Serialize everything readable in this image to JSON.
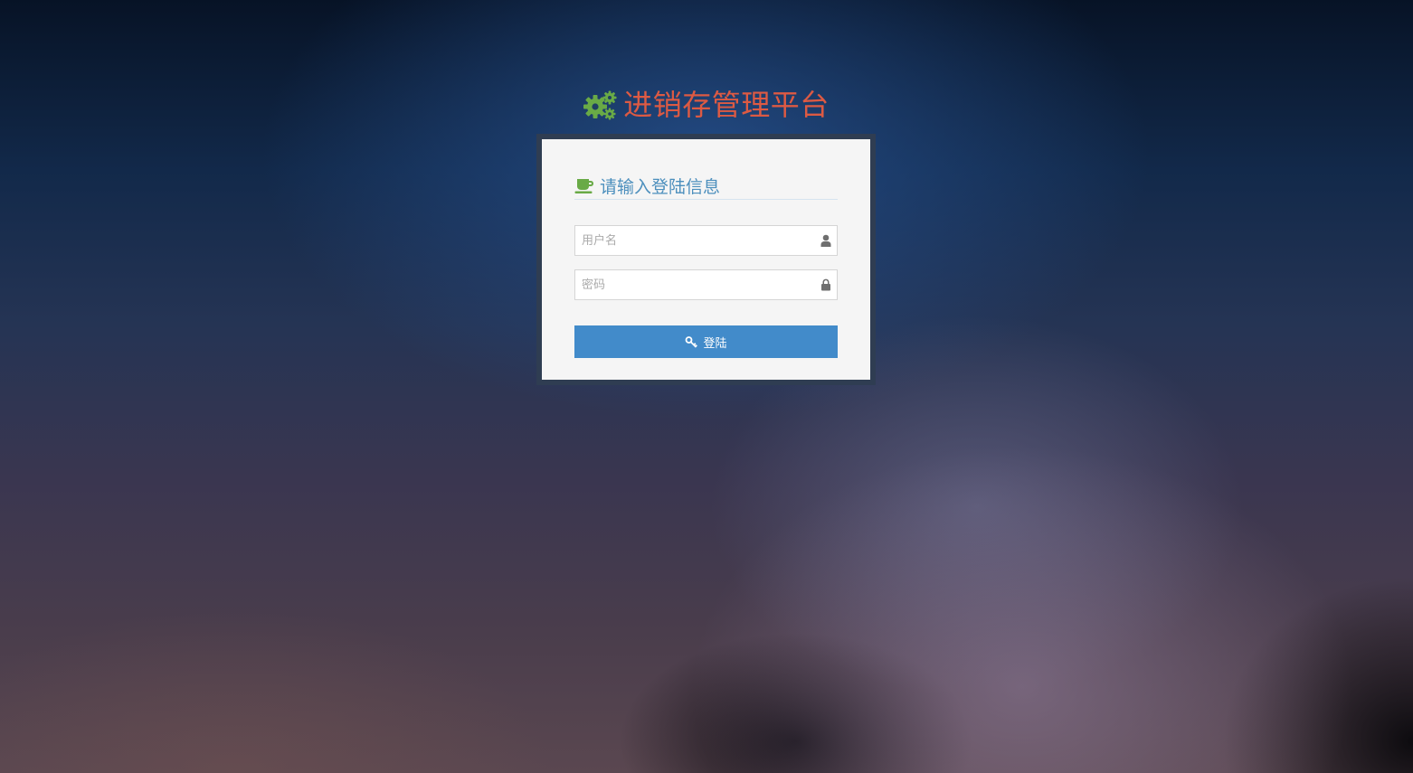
{
  "app": {
    "title": "进销存管理平台",
    "title_color": "#dd5a43",
    "brand_icon": "gears-icon",
    "brand_icon_color": "#69aa46"
  },
  "login": {
    "header": "请输入登陆信息",
    "header_icon": "coffee-icon",
    "header_color": "#4c8fbd",
    "username": {
      "placeholder": "用户名",
      "value": "",
      "icon": "user-icon"
    },
    "password": {
      "placeholder": "密码",
      "value": "",
      "icon": "lock-icon"
    },
    "submit_label": "登陆",
    "submit_icon": "key-icon",
    "submit_color": "#428bca"
  }
}
